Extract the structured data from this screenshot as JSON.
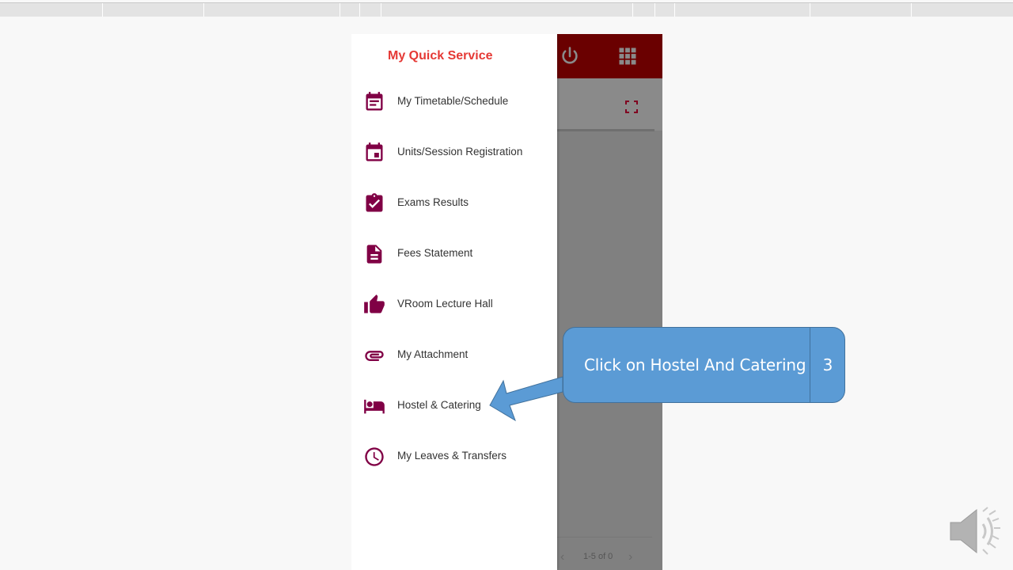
{
  "drawer": {
    "title": "My Quick Service",
    "items": [
      {
        "label": "My Timetable/Schedule",
        "icon": "event-note-icon"
      },
      {
        "label": "Units/Session Registration",
        "icon": "event-icon"
      },
      {
        "label": "Exams Results",
        "icon": "assignment-turned-in-icon"
      },
      {
        "label": "Fees Statement",
        "icon": "description-icon"
      },
      {
        "label": "VRoom Lecture Hall",
        "icon": "thumb-up-icon"
      },
      {
        "label": "My Attachment",
        "icon": "attachment-icon"
      },
      {
        "label": "Hostel & Catering",
        "icon": "hotel-icon"
      },
      {
        "label": "My Leaves & Transfers",
        "icon": "clock-icon"
      }
    ]
  },
  "pager": {
    "text": "1-5 of 0",
    "prev": "‹",
    "next": "›"
  },
  "callout": {
    "text": "Click on Hostel And Catering",
    "step": "3"
  },
  "colors": {
    "accent": "#800045",
    "title_red": "#e53935",
    "appbar": "#6a0000",
    "callout": "#5b9bd5"
  }
}
